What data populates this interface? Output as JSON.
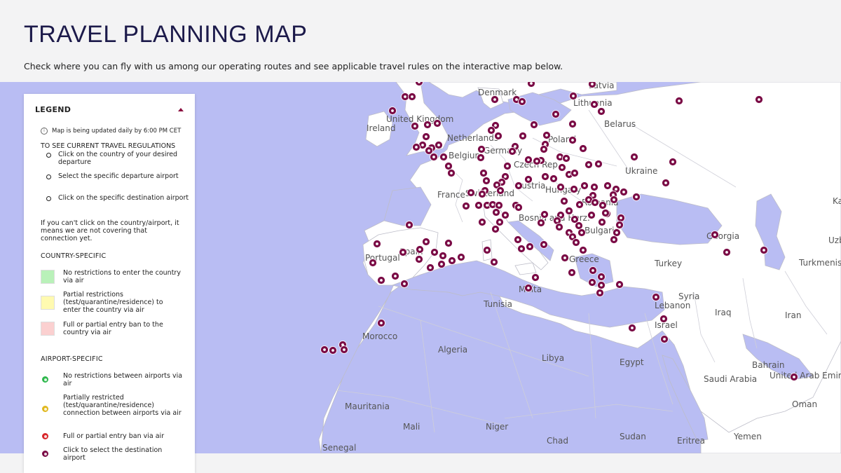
{
  "header": {
    "title": "TRAVEL PLANNING MAP",
    "subtitle": "Check where you can fly with us among our operating routes and see applicable travel rules on the interactive map below."
  },
  "colors": {
    "sea": "#b9bdf3",
    "land": "#ffffff",
    "border": "#bdbdc8",
    "airport": "#7a0a45",
    "green": "#b9f1b9",
    "yellow": "#fffab0",
    "red": "#fbd0d0",
    "dot_green": "#2fb84d",
    "dot_yellow": "#e0b81e",
    "dot_red": "#d8262a",
    "dot_purple": "#7a0a45"
  },
  "legend": {
    "title": "LEGEND",
    "toggle_icon": "caret-up-icon",
    "info_icon": "info-icon",
    "update_note": "Map is being updated daily by 6:00 PM CET",
    "steps_heading": "TO SEE CURRENT TRAVEL REGULATIONS",
    "steps": [
      "Click on the country of your desired departure",
      "Select the specific departure airport",
      "Click on the specific destination airport"
    ],
    "note": "If you can't click on the country/airport, it means we are not covering that connection yet.",
    "country_heading": "COUNTRY-SPECIFIC",
    "country_items": [
      {
        "label": "No restrictions to enter the country via air",
        "color": "#b9f1b9"
      },
      {
        "label": "Partial restrictions (test/quarantine/residence) to enter the country via air",
        "color": "#fffab0"
      },
      {
        "label": "Full or partial entry ban to the country via air",
        "color": "#fbd0d0"
      }
    ],
    "airport_heading": "AIRPORT-SPECIFIC",
    "airport_items": [
      {
        "label": "No restrictions between airports via air",
        "color": "#2fb84d"
      },
      {
        "label": "Partially restricted (test/quarantine/residence) connection between airports via air",
        "color": "#e0b81e"
      },
      {
        "label": "Full or partial entry ban via air",
        "color": "#d8262a"
      },
      {
        "label": "Click to select the destination airport",
        "color": "#7a0a45"
      }
    ]
  },
  "map": {
    "country_labels": [
      {
        "name": "Denmark"
      },
      {
        "name": "Latvia"
      },
      {
        "name": "Lithuania"
      },
      {
        "name": "Belarus"
      },
      {
        "name": "United Kingdom"
      },
      {
        "name": "Ireland"
      },
      {
        "name": "Netherlands"
      },
      {
        "name": "Poland"
      },
      {
        "name": "Belgium"
      },
      {
        "name": "Germany"
      },
      {
        "name": "Czech Rep."
      },
      {
        "name": "Ukraine"
      },
      {
        "name": "France"
      },
      {
        "name": "Switzerland"
      },
      {
        "name": "Austria"
      },
      {
        "name": "Hungary"
      },
      {
        "name": "Romania"
      },
      {
        "name": "Bosnia and Herz."
      },
      {
        "name": "Bulgaria"
      },
      {
        "name": "Georgia"
      },
      {
        "name": "Portugal"
      },
      {
        "name": "Spain"
      },
      {
        "name": "Greece"
      },
      {
        "name": "Turkey"
      },
      {
        "name": "Turkmenistan"
      },
      {
        "name": "Malta"
      },
      {
        "name": "Tunisia"
      },
      {
        "name": "Syria"
      },
      {
        "name": "Lebanon"
      },
      {
        "name": "Israel"
      },
      {
        "name": "Iraq"
      },
      {
        "name": "Iran"
      },
      {
        "name": "Morocco"
      },
      {
        "name": "Algeria"
      },
      {
        "name": "Libya"
      },
      {
        "name": "Egypt"
      },
      {
        "name": "Bahrain"
      },
      {
        "name": "Saudi Arabia"
      },
      {
        "name": "United Arab Emirates"
      },
      {
        "name": "Oman"
      },
      {
        "name": "Mauritania"
      },
      {
        "name": "Mali"
      },
      {
        "name": "Niger"
      },
      {
        "name": "Chad"
      },
      {
        "name": "Sudan"
      },
      {
        "name": "Eritrea"
      },
      {
        "name": "Yemen"
      },
      {
        "name": "Senegal"
      },
      {
        "name": "Uzbekistan"
      },
      {
        "name": "Kazakhstan"
      }
    ]
  }
}
